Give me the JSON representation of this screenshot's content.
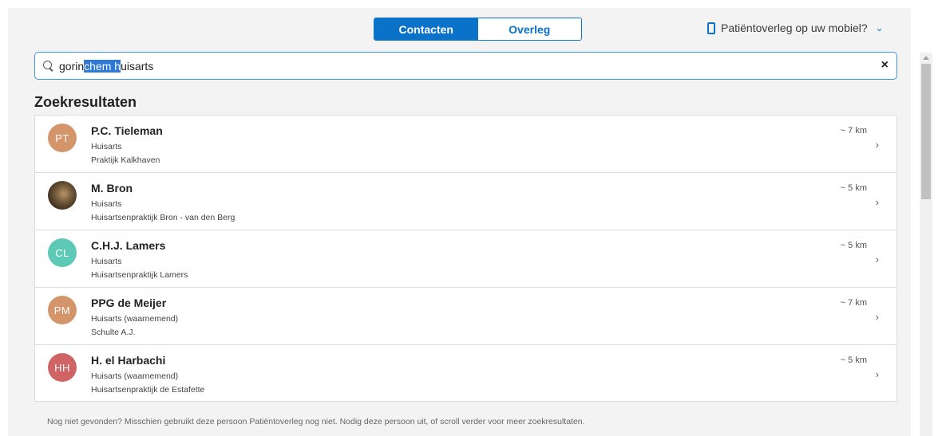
{
  "tabs": [
    {
      "label": "Contacten",
      "active": true
    },
    {
      "label": "Overleg",
      "active": false
    }
  ],
  "mobile_link": {
    "label": "Patiëntoverleg op uw mobiel?",
    "icon": "phone-icon"
  },
  "search": {
    "value_before": "gorin",
    "value_selected": "chem h",
    "value_after": "uisarts",
    "clear_icon": "×"
  },
  "results_heading": "Zoekresultaten",
  "results": [
    {
      "initials": "PT",
      "color": "#d4956b",
      "name": "P.C. Tieleman",
      "role": "Huisarts",
      "org": "Praktijk Kalkhaven",
      "distance": "~ 7 km"
    },
    {
      "initials": "",
      "photo": true,
      "name": "M. Bron",
      "role": "Huisarts",
      "org": "Huisartsenpraktijk Bron - van den Berg",
      "distance": "~ 5 km"
    },
    {
      "initials": "CL",
      "color": "#5ec9b6",
      "name": "C.H.J. Lamers",
      "role": "Huisarts",
      "org": "Huisartsenpraktijk Lamers",
      "distance": "~ 5 km"
    },
    {
      "initials": "PM",
      "color": "#d4956b",
      "name": "PPG de Meijer",
      "role": "Huisarts (waarnemend)",
      "org": "Schulte A.J.",
      "distance": "~ 7 km"
    },
    {
      "initials": "HH",
      "color": "#d06464",
      "name": "H. el Harbachi",
      "role": "Huisarts (waarnemend)",
      "org": "Huisartsenpraktijk de Estafette",
      "distance": "~ 5 km"
    }
  ],
  "footer": "Nog niet gevonden? Misschien gebruikt deze persoon Patiëntoverleg nog niet. Nodig deze persoon uit, of scroll verder voor meer zoekresultaten.",
  "colors": {
    "accent": "#0a73c9",
    "selection": "#2e78d6"
  }
}
